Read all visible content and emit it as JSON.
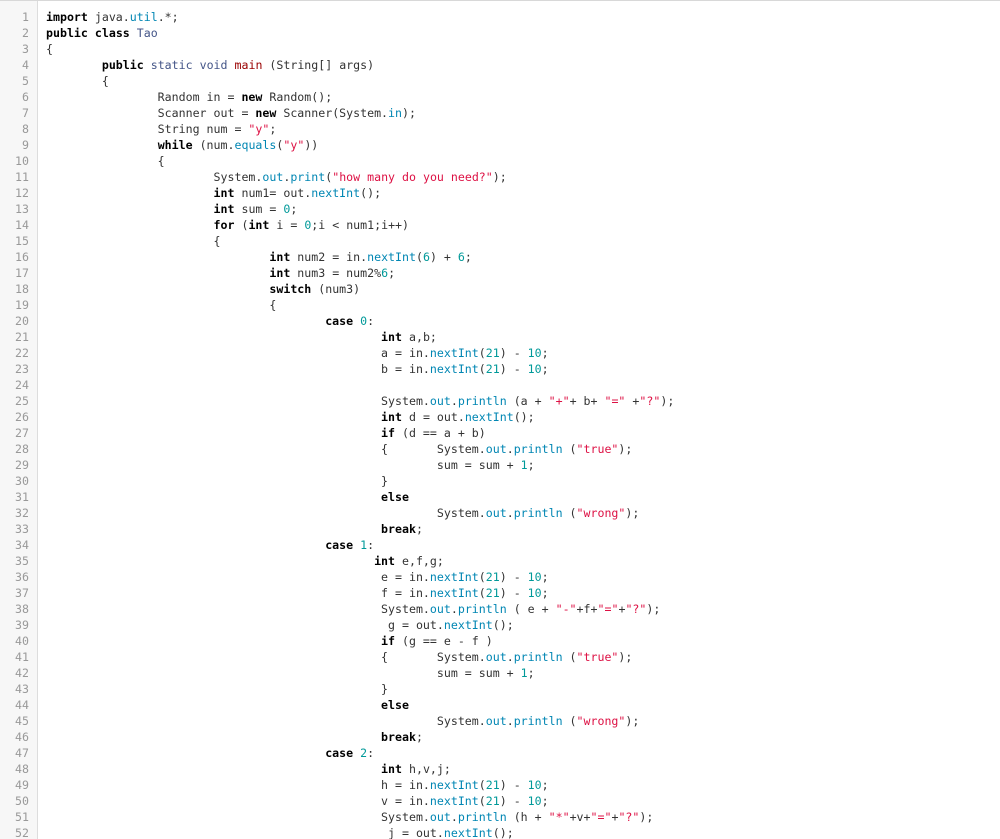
{
  "editor": {
    "lines": [
      {
        "n": "1",
        "t": "import java.util.*;"
      },
      {
        "n": "2",
        "t": "public class Tao"
      },
      {
        "n": "3",
        "t": "{"
      },
      {
        "n": "4",
        "t": "        public static void main (String[] args)"
      },
      {
        "n": "5",
        "t": "        {"
      },
      {
        "n": "6",
        "t": "                Random in = new Random();"
      },
      {
        "n": "7",
        "t": "                Scanner out = new Scanner(System.in);"
      },
      {
        "n": "8",
        "t": "                String num = \"y\";"
      },
      {
        "n": "9",
        "t": "                while (num.equals(\"y\"))"
      },
      {
        "n": "10",
        "t": "                {"
      },
      {
        "n": "11",
        "t": "                        System.out.print(\"how many do you need?\");"
      },
      {
        "n": "12",
        "t": "                        int num1= out.nextInt();"
      },
      {
        "n": "13",
        "t": "                        int sum = 0;"
      },
      {
        "n": "14",
        "t": "                        for (int i = 0;i < num1;i++)"
      },
      {
        "n": "15",
        "t": "                        {"
      },
      {
        "n": "16",
        "t": "                                int num2 = in.nextInt(6) + 6;"
      },
      {
        "n": "17",
        "t": "                                int num3 = num2%6;"
      },
      {
        "n": "18",
        "t": "                                switch (num3)"
      },
      {
        "n": "19",
        "t": "                                {"
      },
      {
        "n": "20",
        "t": "                                        case 0:"
      },
      {
        "n": "21",
        "t": "                                                int a,b;"
      },
      {
        "n": "22",
        "t": "                                                a = in.nextInt(21) - 10;"
      },
      {
        "n": "23",
        "t": "                                                b = in.nextInt(21) - 10;"
      },
      {
        "n": "24",
        "t": ""
      },
      {
        "n": "25",
        "t": "                                                System.out.println (a + \"+\"+ b+ \"=\" +\"?\");"
      },
      {
        "n": "26",
        "t": "                                                int d = out.nextInt();"
      },
      {
        "n": "27",
        "t": "                                                if (d == a + b)"
      },
      {
        "n": "28",
        "t": "                                                {       System.out.println (\"true\");"
      },
      {
        "n": "29",
        "t": "                                                        sum = sum + 1;"
      },
      {
        "n": "30",
        "t": "                                                }"
      },
      {
        "n": "31",
        "t": "                                                else"
      },
      {
        "n": "32",
        "t": "                                                        System.out.println (\"wrong\");"
      },
      {
        "n": "33",
        "t": "                                                break;"
      },
      {
        "n": "34",
        "t": "                                        case 1:"
      },
      {
        "n": "35",
        "t": "                                               int e,f,g;"
      },
      {
        "n": "36",
        "t": "                                                e = in.nextInt(21) - 10;"
      },
      {
        "n": "37",
        "t": "                                                f = in.nextInt(21) - 10;"
      },
      {
        "n": "38",
        "t": "                                                System.out.println ( e + \"-\"+f+\"=\"+\"?\");"
      },
      {
        "n": "39",
        "t": "                                                 g = out.nextInt();"
      },
      {
        "n": "40",
        "t": "                                                if (g == e - f )"
      },
      {
        "n": "41",
        "t": "                                                {       System.out.println (\"true\");"
      },
      {
        "n": "42",
        "t": "                                                        sum = sum + 1;"
      },
      {
        "n": "43",
        "t": "                                                }"
      },
      {
        "n": "44",
        "t": "                                                else"
      },
      {
        "n": "45",
        "t": "                                                        System.out.println (\"wrong\");"
      },
      {
        "n": "46",
        "t": "                                                break;"
      },
      {
        "n": "47",
        "t": "                                        case 2:"
      },
      {
        "n": "48",
        "t": "                                                int h,v,j;"
      },
      {
        "n": "49",
        "t": "                                                h = in.nextInt(21) - 10;"
      },
      {
        "n": "50",
        "t": "                                                v = in.nextInt(21) - 10;"
      },
      {
        "n": "51",
        "t": "                                                System.out.println (h + \"*\"+v+\"=\"+\"?\");"
      },
      {
        "n": "52",
        "t": "                                                 j = out.nextInt();"
      }
    ]
  },
  "colors": {
    "keyword": "#000000",
    "type": "#445588",
    "string": "#dd1144",
    "number": "#009999",
    "member": "#0086b3",
    "function_name": "#990000",
    "line_number": "#999999",
    "gutter_bg": "#f7f7f7"
  }
}
